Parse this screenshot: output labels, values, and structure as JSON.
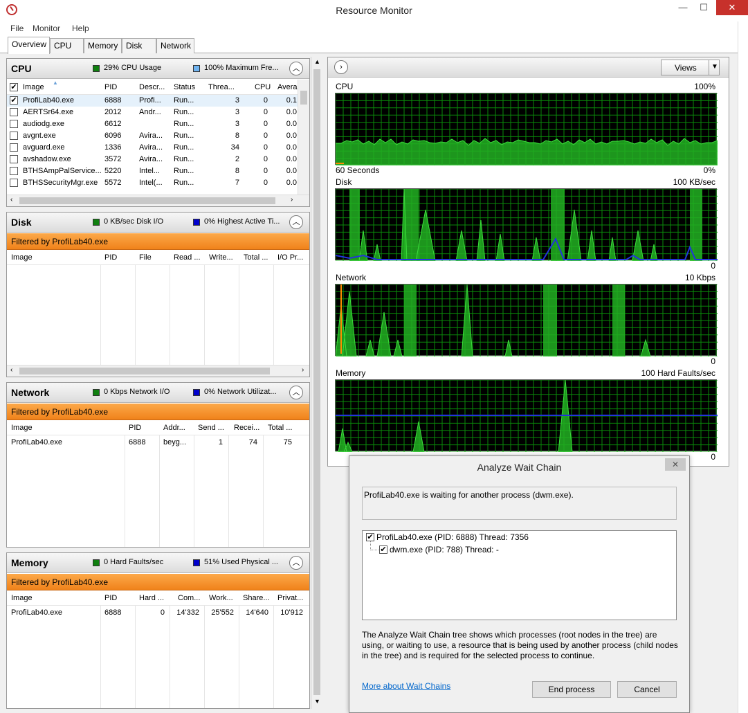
{
  "window": {
    "title": "Resource Monitor",
    "minimize": "—",
    "maximize": "☐",
    "close": "✕"
  },
  "menu": [
    "File",
    "Monitor",
    "Help"
  ],
  "tabs": [
    "Overview",
    "CPU",
    "Memory",
    "Disk",
    "Network"
  ],
  "cpu_panel": {
    "title": "CPU",
    "usage": "29% CPU Usage",
    "freq": "100% Maximum Fre...",
    "columns": [
      "Image",
      "PID",
      "Descr...",
      "Status",
      "Threa...",
      "CPU",
      "Avera"
    ],
    "rows": [
      {
        "checked": "✔",
        "image": "ProfiLab40.exe",
        "pid": "6888",
        "desc": "Profi...",
        "status": "Run...",
        "threads": "3",
        "cpu": "0",
        "avg": "0.1"
      },
      {
        "checked": "",
        "image": "AERTSr64.exe",
        "pid": "2012",
        "desc": "Andr...",
        "status": "Run...",
        "threads": "3",
        "cpu": "0",
        "avg": "0.0"
      },
      {
        "checked": "",
        "image": "audiodg.exe",
        "pid": "6612",
        "desc": "",
        "status": "Run...",
        "threads": "3",
        "cpu": "0",
        "avg": "0.0"
      },
      {
        "checked": "",
        "image": "avgnt.exe",
        "pid": "6096",
        "desc": "Avira...",
        "status": "Run...",
        "threads": "8",
        "cpu": "0",
        "avg": "0.0"
      },
      {
        "checked": "",
        "image": "avguard.exe",
        "pid": "1336",
        "desc": "Avira...",
        "status": "Run...",
        "threads": "34",
        "cpu": "0",
        "avg": "0.0"
      },
      {
        "checked": "",
        "image": "avshadow.exe",
        "pid": "3572",
        "desc": "Avira...",
        "status": "Run...",
        "threads": "2",
        "cpu": "0",
        "avg": "0.0"
      },
      {
        "checked": "",
        "image": "BTHSAmpPalService...",
        "pid": "5220",
        "desc": "Intel...",
        "status": "Run...",
        "threads": "8",
        "cpu": "0",
        "avg": "0.0"
      },
      {
        "checked": "",
        "image": "BTHSSecurityMgr.exe",
        "pid": "5572",
        "desc": "Intel(...",
        "status": "Run...",
        "threads": "7",
        "cpu": "0",
        "avg": "0.0"
      }
    ]
  },
  "disk_panel": {
    "title": "Disk",
    "io": "0 KB/sec Disk I/O",
    "active": "0% Highest Active Ti...",
    "filter": "Filtered by ProfiLab40.exe",
    "columns": [
      "Image",
      "PID",
      "File",
      "Read ...",
      "Write...",
      "Total ...",
      "I/O Pr..."
    ]
  },
  "network_panel": {
    "title": "Network",
    "io": "0 Kbps Network I/O",
    "util": "0% Network Utilizat...",
    "filter": "Filtered by ProfiLab40.exe",
    "columns": [
      "Image",
      "PID",
      "Addr...",
      "Send ...",
      "Recei...",
      "Total ..."
    ],
    "rows": [
      {
        "image": "ProfiLab40.exe",
        "pid": "6888",
        "addr": "beyg...",
        "send": "1",
        "recv": "74",
        "total": "75"
      }
    ]
  },
  "memory_panel": {
    "title": "Memory",
    "faults": "0 Hard Faults/sec",
    "used": "51% Used Physical ...",
    "filter": "Filtered by ProfiLab40.exe",
    "columns": [
      "Image",
      "PID",
      "Hard ...",
      "Com...",
      "Work...",
      "Share...",
      "Privat..."
    ],
    "rows": [
      {
        "image": "ProfiLab40.exe",
        "pid": "6888",
        "hard": "0",
        "commit": "14'332",
        "working": "25'552",
        "share": "14'640",
        "private": "10'912"
      }
    ]
  },
  "graphs": {
    "views_label": "Views",
    "expand_icon": "chevron-right-icon",
    "items": [
      {
        "name": "CPU",
        "max": "100%",
        "min": "0%",
        "duration": "60 Seconds"
      },
      {
        "name": "Disk",
        "max": "100 KB/sec",
        "min": "0",
        "duration": ""
      },
      {
        "name": "Network",
        "max": "10 Kbps",
        "min": "0",
        "duration": ""
      },
      {
        "name": "Memory",
        "max": "100 Hard Faults/sec",
        "min": "0",
        "duration": ""
      }
    ]
  },
  "dialog": {
    "title": "Analyze Wait Chain",
    "message": "ProfiLab40.exe is waiting for another process (dwm.exe).",
    "tree_root": "ProfiLab40.exe (PID: 6888) Thread: 7356",
    "tree_child": "dwm.exe (PID: 788) Thread: -",
    "description": "The Analyze Wait Chain tree shows which processes (root nodes in the tree) are using, or waiting to use, a resource that is being used by another process (child nodes in the tree) and is required for the selected process to continue.",
    "link": "More about Wait Chains",
    "end_process": "End process",
    "cancel": "Cancel"
  },
  "colors": {
    "graph_green": "#1fa81f",
    "graph_grid": "#0a8a0a",
    "accent_orange": "#f0821a",
    "line_blue": "#2233dd"
  }
}
